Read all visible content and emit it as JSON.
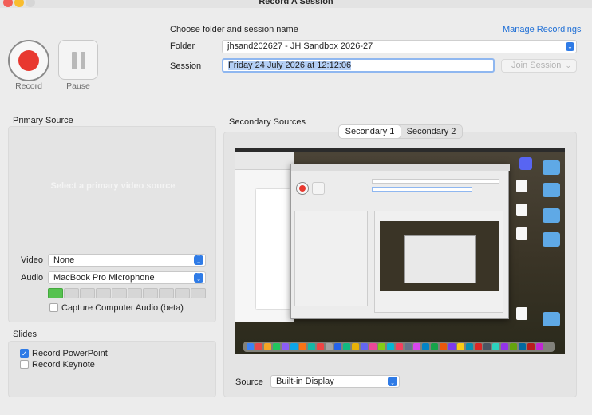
{
  "window": {
    "title": "Record A Session"
  },
  "controls": {
    "record_label": "Record",
    "pause_label": "Pause"
  },
  "header": {
    "heading": "Choose folder and session name",
    "manage_link": "Manage Recordings",
    "folder_label": "Folder",
    "folder_value": "jhsand202627 - JH Sandbox 2026-27",
    "session_label": "Session",
    "session_value": "Friday 24 July 2026 at 12:12:06",
    "join_label": "Join Session"
  },
  "primary": {
    "title": "Primary Source",
    "placeholder": "Select a primary video source",
    "video_label": "Video",
    "video_value": "None",
    "audio_label": "Audio",
    "audio_value": "MacBook Pro Microphone",
    "audio_level": 0.1,
    "capture_label": "Capture Computer Audio (beta)",
    "capture_checked": false
  },
  "slides": {
    "title": "Slides",
    "powerpoint_label": "Record PowerPoint",
    "powerpoint_checked": true,
    "keynote_label": "Record Keynote",
    "keynote_checked": false
  },
  "secondary": {
    "title": "Secondary Sources",
    "tabs": [
      "Secondary 1",
      "Secondary 2"
    ],
    "active_tab": 0,
    "source_label": "Source",
    "source_value": "Built-in Display"
  },
  "colors": {
    "accent": "#2f7be6",
    "record": "#e8382f",
    "meter_on": "#56c24f"
  }
}
